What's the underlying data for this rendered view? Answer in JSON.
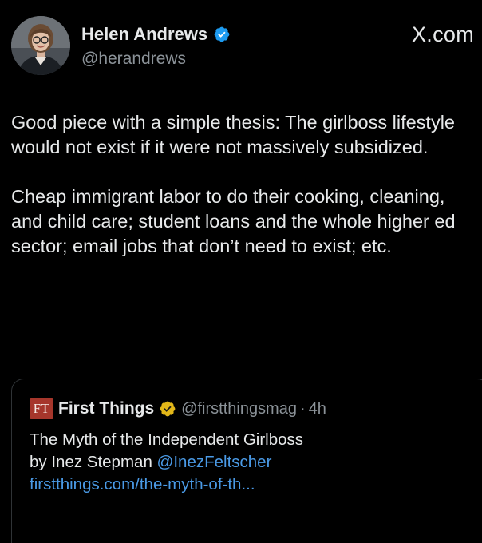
{
  "author": {
    "display_name": "Helen Andrews",
    "handle": "@herandrews",
    "verified": true
  },
  "site_label": "X.com",
  "tweet": {
    "paragraphs": [
      "Good piece with a simple thesis: The girlboss lifestyle would not exist if it were not massively subsidized.",
      "Cheap immigrant labor to do their cooking, cleaning, and child care; student loans and the whole higher ed sector; email jobs that don’t need to exist; etc."
    ]
  },
  "quoted_post": {
    "logo_text": "FT",
    "display_name": "First Things",
    "handle": "@firstthingsmag",
    "separator": "·",
    "time": "4h",
    "line1": "The Myth of the Independent Girlboss",
    "line2_prefix": "by Inez Stepman ",
    "mention": "@InezFeltscher",
    "link": "firstthings.com/the-myth-of-th..."
  },
  "colors": {
    "background": "#000000",
    "text": "#e7e9ea",
    "secondary_text": "#8b9298",
    "link": "#4a9ae6",
    "verified_blue": "#1d9bf0",
    "verified_gold": "#e2b719",
    "ft_logo_bg": "#a6362b"
  },
  "icons": {
    "verified_badge": "verified-badge-icon",
    "gold_badge": "gold-verified-badge-icon",
    "avatar": "profile-photo"
  }
}
